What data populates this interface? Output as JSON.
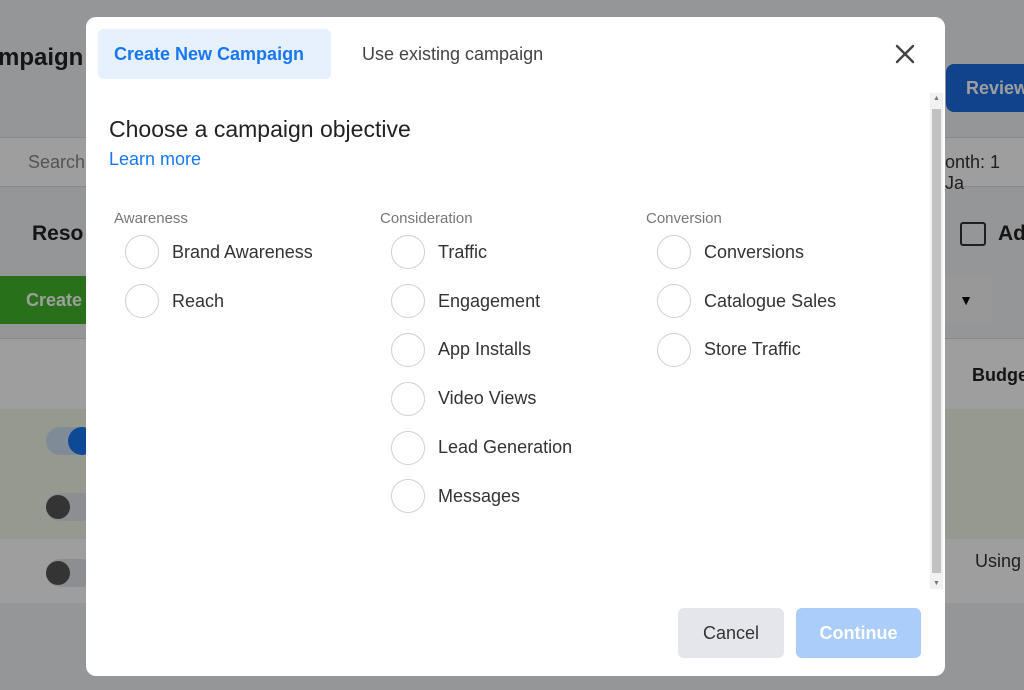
{
  "background": {
    "title_fragment": "mpaign",
    "review_button": "Review",
    "search_placeholder": "Search",
    "date_fragment": "onth: 1 Ja",
    "resources_header": "Reso",
    "ads_header": "Ad",
    "create_button": "Create",
    "budget_header": "Budge",
    "budget_cell": "Using"
  },
  "modal": {
    "tabs": [
      {
        "label": "Create New Campaign",
        "active": true
      },
      {
        "label": "Use existing campaign",
        "active": false
      }
    ],
    "title": "Choose a campaign objective",
    "learn_more": "Learn more",
    "columns": [
      {
        "header": "Awareness",
        "options": [
          "Brand Awareness",
          "Reach"
        ]
      },
      {
        "header": "Consideration",
        "options": [
          "Traffic",
          "Engagement",
          "App Installs",
          "Video Views",
          "Lead Generation",
          "Messages"
        ]
      },
      {
        "header": "Conversion",
        "options": [
          "Conversions",
          "Catalogue Sales",
          "Store Traffic"
        ]
      }
    ],
    "cancel": "Cancel",
    "continue": "Continue",
    "accent": "#1877f2"
  }
}
